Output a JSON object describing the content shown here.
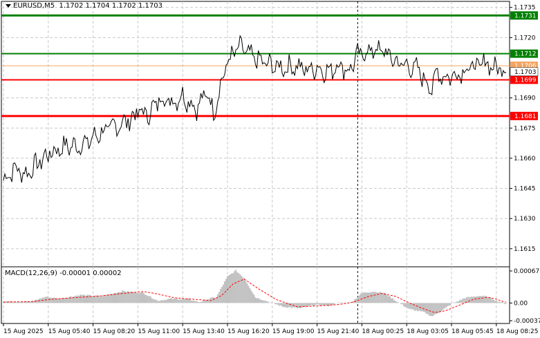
{
  "header": {
    "symbol": "EURUSD,M5",
    "ohlc": "1.1702 1.1704 1.1702 1.1703"
  },
  "macd_panel": {
    "label": "MACD(12,26,9) -0.00001 0.00002"
  },
  "colors": {
    "price_line": "#000000",
    "support_line": "#ff0000",
    "resistance_line": "#008000",
    "orange_line": "#f4a460",
    "histogram": "#c0c0c0",
    "signal": "#ff0000",
    "grid": "#c8c8c8"
  },
  "chart_data": [
    {
      "type": "line",
      "name": "price",
      "ylim": [
        1.1606,
        1.1738
      ],
      "y_ticks": [
        "1.1735",
        "1.1720",
        "1.1690",
        "1.1675",
        "1.1660",
        "1.1645",
        "1.1630",
        "1.1615"
      ],
      "x_tick_labels": [
        "15 Aug 2025",
        "15 Aug 05:40",
        "15 Aug 08:20",
        "15 Aug 11:00",
        "15 Aug 13:40",
        "15 Aug 16:20",
        "15 Aug 19:00",
        "15 Aug 21:40",
        "18 Aug 00:25",
        "18 Aug 03:05",
        "18 Aug 05:45",
        "18 Aug 08:25"
      ],
      "x_tick_index": [
        0,
        32,
        64,
        96,
        128,
        160,
        192,
        224,
        256,
        288,
        320,
        352
      ],
      "session_break_index": 253,
      "grid": true,
      "horizontal_levels": [
        {
          "value": 1.1731,
          "label": "1.1731",
          "color": "#008000",
          "width": 3
        },
        {
          "value": 1.1712,
          "label": "1.1712",
          "color": "#008000",
          "width": 2
        },
        {
          "value": 1.1706,
          "label": "1.1706",
          "color": "#f4a460",
          "width": 1
        },
        {
          "value": 1.1699,
          "label": "1.1699",
          "color": "#ff0000",
          "width": 2
        },
        {
          "value": 1.1681,
          "label": "1.1681",
          "color": "#ff0000",
          "width": 3
        }
      ],
      "current": {
        "value": 1.1703,
        "label": "1.1703"
      },
      "anchors": [
        [
          0,
          1.1649
        ],
        [
          8,
          1.1655
        ],
        [
          16,
          1.1652
        ],
        [
          24,
          1.1657
        ],
        [
          32,
          1.1662
        ],
        [
          44,
          1.1666
        ],
        [
          52,
          1.1666
        ],
        [
          60,
          1.1668
        ],
        [
          70,
          1.1673
        ],
        [
          80,
          1.1676
        ],
        [
          90,
          1.1679
        ],
        [
          96,
          1.1683
        ],
        [
          104,
          1.1682
        ],
        [
          112,
          1.169
        ],
        [
          120,
          1.1688
        ],
        [
          128,
          1.1691
        ],
        [
          138,
          1.1685
        ],
        [
          146,
          1.1693
        ],
        [
          150,
          1.1682
        ],
        [
          153,
          1.1691
        ],
        [
          160,
          1.1708
        ],
        [
          168,
          1.1715
        ],
        [
          172,
          1.1714
        ],
        [
          176,
          1.1711
        ],
        [
          184,
          1.1708
        ],
        [
          192,
          1.1706
        ],
        [
          200,
          1.1705
        ],
        [
          208,
          1.1706
        ],
        [
          216,
          1.1704
        ],
        [
          224,
          1.1705
        ],
        [
          232,
          1.1703
        ],
        [
          240,
          1.1707
        ],
        [
          246,
          1.1703
        ],
        [
          253,
          1.1711
        ],
        [
          260,
          1.1713
        ],
        [
          266,
          1.1714
        ],
        [
          272,
          1.1713
        ],
        [
          280,
          1.1708
        ],
        [
          288,
          1.1706
        ],
        [
          296,
          1.1704
        ],
        [
          302,
          1.1698
        ],
        [
          306,
          1.1695
        ],
        [
          310,
          1.1703
        ],
        [
          316,
          1.17
        ],
        [
          324,
          1.1702
        ],
        [
          332,
          1.1705
        ],
        [
          340,
          1.1706
        ],
        [
          346,
          1.1708
        ],
        [
          350,
          1.1704
        ],
        [
          354,
          1.1706
        ],
        [
          358,
          1.1703
        ]
      ]
    },
    {
      "type": "bar",
      "name": "MACD(12,26,9)",
      "ylim": [
        -0.00037,
        0.00067
      ],
      "y_ticks": [
        "0.00067",
        "0.00",
        "-0.00037"
      ],
      "macd_value": -1e-05,
      "signal_value": 2e-05,
      "histogram_anchors": [
        [
          0,
          3e-05
        ],
        [
          20,
          3e-05
        ],
        [
          30,
          0.00013
        ],
        [
          40,
          9e-05
        ],
        [
          55,
          0.00017
        ],
        [
          70,
          0.00014
        ],
        [
          85,
          0.00025
        ],
        [
          100,
          0.00021
        ],
        [
          110,
          5e-05
        ],
        [
          120,
          9e-05
        ],
        [
          132,
          8e-05
        ],
        [
          140,
          2e-05
        ],
        [
          148,
          0.0001
        ],
        [
          152,
          0.00012
        ],
        [
          160,
          0.00055
        ],
        [
          166,
          0.00068
        ],
        [
          172,
          0.00052
        ],
        [
          180,
          0.00012
        ],
        [
          190,
          2e-05
        ],
        [
          200,
          -8e-05
        ],
        [
          212,
          -0.00011
        ],
        [
          222,
          -4e-05
        ],
        [
          232,
          -6e-05
        ],
        [
          240,
          1e-05
        ],
        [
          248,
          0.0
        ],
        [
          256,
          0.00021
        ],
        [
          264,
          0.00024
        ],
        [
          272,
          0.00021
        ],
        [
          280,
          5e-05
        ],
        [
          290,
          -0.00013
        ],
        [
          300,
          -0.00019
        ],
        [
          306,
          -0.00028
        ],
        [
          312,
          -0.00018
        ],
        [
          320,
          -2e-05
        ],
        [
          330,
          0.00011
        ],
        [
          340,
          0.00015
        ],
        [
          346,
          0.00013
        ],
        [
          352,
          5e-05
        ],
        [
          358,
          -1e-05
        ]
      ],
      "signal_anchors": [
        [
          0,
          2e-05
        ],
        [
          20,
          3e-05
        ],
        [
          35,
          8e-05
        ],
        [
          55,
          0.00012
        ],
        [
          70,
          0.00015
        ],
        [
          85,
          0.0002
        ],
        [
          100,
          0.00024
        ],
        [
          110,
          0.00019
        ],
        [
          122,
          0.00011
        ],
        [
          135,
          8e-05
        ],
        [
          148,
          5e-05
        ],
        [
          156,
          0.00016
        ],
        [
          164,
          0.0004
        ],
        [
          172,
          0.0005
        ],
        [
          182,
          0.0003
        ],
        [
          195,
          7e-05
        ],
        [
          210,
          -8e-05
        ],
        [
          225,
          -6e-05
        ],
        [
          240,
          -3e-05
        ],
        [
          250,
          2e-05
        ],
        [
          260,
          0.00013
        ],
        [
          270,
          0.0002
        ],
        [
          280,
          0.00014
        ],
        [
          290,
          0.0
        ],
        [
          300,
          -0.00012
        ],
        [
          308,
          -0.0002
        ],
        [
          316,
          -0.00016
        ],
        [
          326,
          -4e-05
        ],
        [
          336,
          8e-05
        ],
        [
          346,
          0.00012
        ],
        [
          352,
          8e-05
        ],
        [
          358,
          2e-05
        ]
      ]
    }
  ]
}
